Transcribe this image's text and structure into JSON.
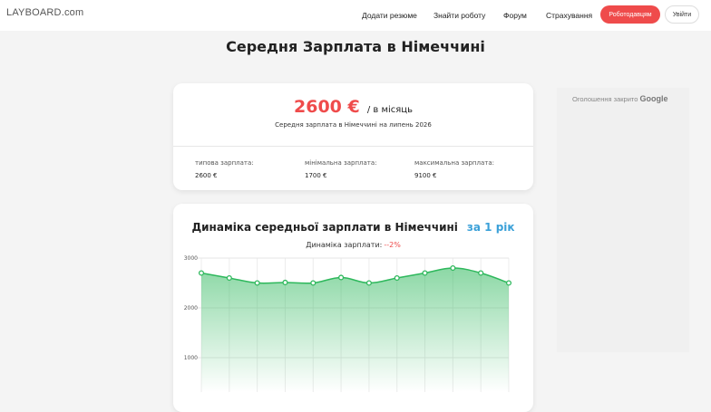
{
  "header": {
    "logo": "LAYBOARD.com",
    "nav": [
      "Додати резюме",
      "Знайти роботу",
      "Форум",
      "Страхування"
    ],
    "employer_button": "Роботодавцям",
    "login_button": "Увійти"
  },
  "page_title": "Середня Зарплата в Німеччині",
  "summary": {
    "amount": "2600 €",
    "period": "/ в місяць",
    "subtitle": "Середня зарплата в Німеччині на липень 2026",
    "stats": [
      {
        "label": "типова зарплата:",
        "value": "2600 €"
      },
      {
        "label": "мінімальна зарплата:",
        "value": "1700 €"
      },
      {
        "label": "максимальна зарплата:",
        "value": "9100 €"
      }
    ]
  },
  "dynamics": {
    "title": "Динаміка середньої зарплати в Німеччині",
    "range_link": "за 1 рік",
    "change_label": "Динаміка зарплати:",
    "change_value": "--2%"
  },
  "ad": {
    "text": "Оголошення закрито",
    "brand": "Google"
  },
  "colors": {
    "accent_red": "#ef4b4b",
    "accent_blue": "#3aa0d8",
    "line_green": "#2eb85c"
  },
  "chart_data": {
    "type": "area",
    "title": "",
    "xlabel": "",
    "ylabel": "",
    "x": [
      1,
      2,
      3,
      4,
      5,
      6,
      7,
      8,
      9,
      10,
      11,
      12
    ],
    "values": [
      2700,
      2600,
      2500,
      2510,
      2500,
      2610,
      2500,
      2600,
      2700,
      2800,
      2700,
      2500
    ],
    "y_ticks": [
      "3000",
      "2000",
      "1000"
    ],
    "ylim": [
      0,
      3000
    ],
    "grid": true
  }
}
